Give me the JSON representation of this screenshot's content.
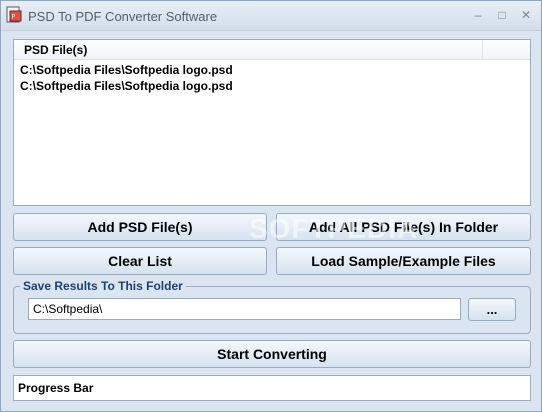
{
  "window": {
    "title": "PSD To PDF Converter Software",
    "controls": {
      "minimize": "–",
      "maximize": "□",
      "close": "✕"
    }
  },
  "file_list": {
    "column_header": "PSD File(s)",
    "rows": [
      "C:\\Softpedia Files\\Softpedia logo.psd",
      "C:\\Softpedia Files\\Softpedia logo.psd"
    ]
  },
  "buttons": {
    "add_files": "Add PSD File(s)",
    "add_folder": "Add All PSD File(s) In Folder",
    "clear_list": "Clear List",
    "load_samples": "Load Sample/Example Files",
    "browse": "...",
    "start": "Start Converting"
  },
  "output_folder": {
    "label": "Save Results To This Folder",
    "value": "C:\\Softpedia\\"
  },
  "progress": {
    "label": "Progress Bar"
  },
  "watermark": "SOFTPEDIA"
}
